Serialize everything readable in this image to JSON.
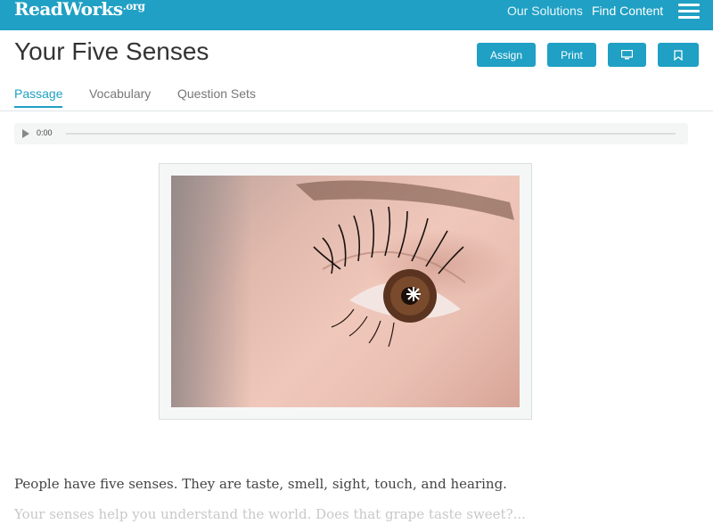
{
  "topbar": {
    "logo": "ReadWorks",
    "logo_suffix": ".org",
    "nav": {
      "solutions": "Our Solutions",
      "find_content": "Find Content"
    }
  },
  "header": {
    "title": "Your Five Senses",
    "buttons": {
      "assign": "Assign",
      "print": "Print"
    }
  },
  "tabs": [
    "Passage",
    "Vocabulary",
    "Question Sets"
  ],
  "active_tab": "Passage",
  "audio": {
    "time": "0:00",
    "progress": 0
  },
  "passage": {
    "paragraphs": [
      "People have five senses. They are taste, smell, sight, touch, and hearing.",
      "Your senses help you understand the world. Does that grape taste sweet?..."
    ]
  },
  "colors": {
    "brand": "#1fa0c4",
    "text": "#333333",
    "tab_active": "#1fa0c4"
  },
  "icons": {
    "menu": "hamburger-icon",
    "present": "monitor-icon",
    "bookmark": "bookmark-icon",
    "play": "play-icon"
  }
}
